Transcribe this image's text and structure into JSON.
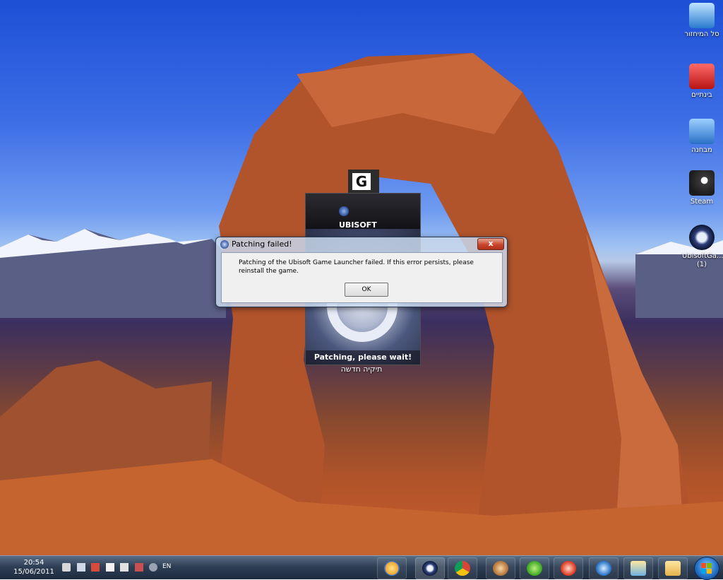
{
  "desktop_icons": [
    {
      "label": "סל המיחזור",
      "icon": "recycle-bin-icon"
    },
    {
      "label": "בינתיים",
      "icon": "folder-icon"
    },
    {
      "label": "מבחנה",
      "icon": "network-folder-icon"
    },
    {
      "label": "Steam",
      "icon": "steam-icon"
    },
    {
      "label": "UbisoftGa... (1)",
      "icon": "ubisoft-icon"
    }
  ],
  "launcher": {
    "badge_letter": "G",
    "brand": "UBISOFT",
    "status": "Patching, please wait!",
    "caption": "תיקיה חדשה"
  },
  "dialog": {
    "title": "Patching failed!",
    "message": "Patching of the Ubisoft Game Launcher failed. If this error persists, please reinstall the game.",
    "ok_label": "OK",
    "close_label": "x"
  },
  "taskbar": {
    "time": "20:54",
    "date": "15/06/2011",
    "language": "EN",
    "tray_icons": [
      "volume-icon",
      "network-icon",
      "blocked-icon",
      "flag-icon",
      "speaker-icon",
      "mute-icon",
      "steam-tray-icon"
    ],
    "pinned": [
      "paint-icon",
      "ubisoft-icon",
      "chrome-icon",
      "game-icon",
      "utorrent-icon",
      "ccleaner-icon",
      "media-icon",
      "remote-icon",
      "explorer-icon"
    ]
  },
  "colors": {
    "taskbar": "#2f3f55",
    "dialog_close": "#c9452c",
    "sky": "#2a5fdf"
  }
}
